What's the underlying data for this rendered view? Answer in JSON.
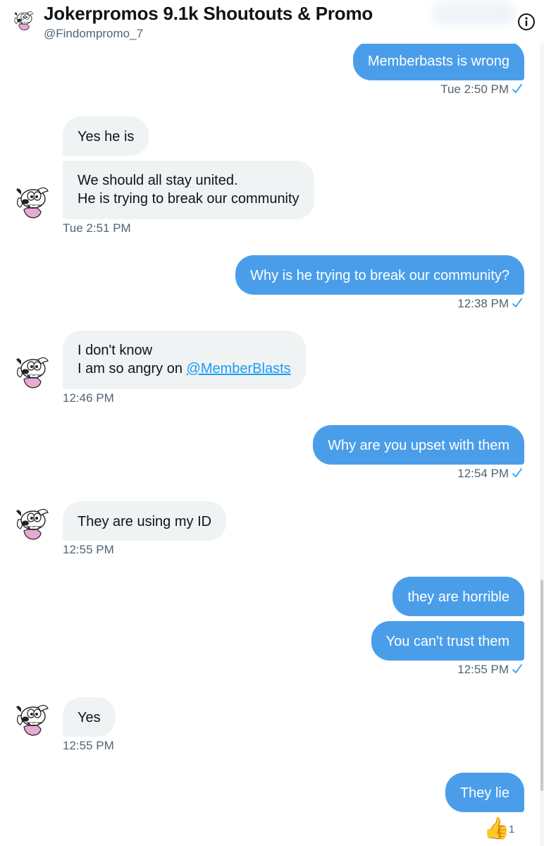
{
  "header": {
    "title": "Jokerpromos 9.1k Shoutouts & Promo",
    "handle": "@Findompromo_7"
  },
  "messages": [
    {
      "id": "m1",
      "dir": "out",
      "text": "Memberbasts is wrong"
    },
    {
      "id": "m2",
      "dir": "in",
      "text": "Yes he is"
    },
    {
      "id": "m3",
      "dir": "in",
      "lines": [
        "We should all stay united.",
        "He is trying to break our community"
      ]
    },
    {
      "id": "m4",
      "dir": "out",
      "text": "Why is he trying to break our community?"
    },
    {
      "id": "m5",
      "dir": "in",
      "lines": [
        "I don't know",
        "I am so angry on "
      ],
      "mention": "@MemberBlasts"
    },
    {
      "id": "m6",
      "dir": "out",
      "text": "Why are you upset with them"
    },
    {
      "id": "m7",
      "dir": "in",
      "text": "They are using my ID"
    },
    {
      "id": "m8",
      "dir": "out",
      "text": "they are horrible"
    },
    {
      "id": "m9",
      "dir": "out",
      "text": "You can't trust them"
    },
    {
      "id": "m10",
      "dir": "in",
      "text": "Yes"
    },
    {
      "id": "m11",
      "dir": "out",
      "text": "They lie"
    }
  ],
  "timestamps": {
    "t1": "Tue 2:50 PM",
    "t2": "Tue 2:51 PM",
    "t3": "12:38 PM",
    "t4": "12:46 PM",
    "t5": "12:54 PM",
    "t6": "12:55 PM",
    "t7": "12:55 PM",
    "t8": "12:55 PM"
  },
  "reaction": {
    "emoji": "👍",
    "count": "1"
  },
  "colors": {
    "outgoing": "#4a9ee9",
    "incoming": "#eff3f4",
    "link": "#1d9bf0",
    "muted": "#536471"
  },
  "icons": {
    "info": "info-icon",
    "sent": "checkmark-icon",
    "avatar": "cartoon-dog-avatar"
  }
}
